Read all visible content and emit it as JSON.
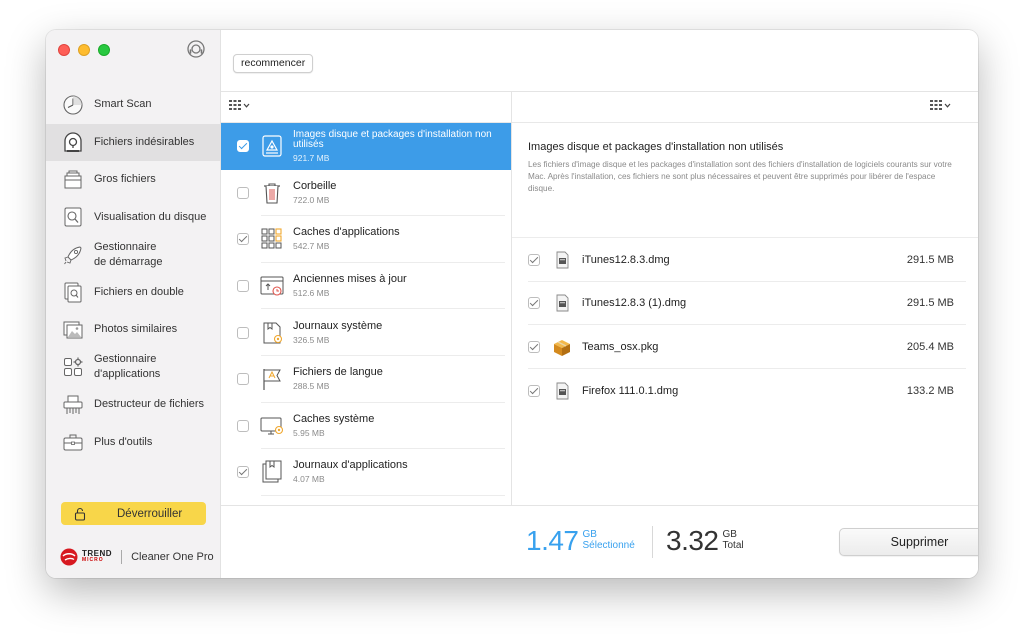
{
  "colors": {
    "accent": "#3d9ce8",
    "selected_stat": "#38a1ee",
    "unlock": "#f8d649"
  },
  "sidebar": {
    "items": [
      {
        "label": "Smart Scan",
        "icon": "smart-scan-icon"
      },
      {
        "label": "Fichiers indésirables",
        "icon": "junk-files-icon",
        "active": true
      },
      {
        "label": "Gros fichiers",
        "icon": "big-files-icon"
      },
      {
        "label": "Visualisation du disque",
        "icon": "disk-map-icon"
      },
      {
        "label_line1": "Gestionnaire",
        "label_line2": "de démarrage",
        "icon": "startup-manager-icon"
      },
      {
        "label": "Fichiers en double",
        "icon": "duplicate-files-icon"
      },
      {
        "label": "Photos similaires",
        "icon": "similar-photos-icon"
      },
      {
        "label_line1": "Gestionnaire",
        "label_line2": "d'applications",
        "icon": "app-manager-icon"
      },
      {
        "label": "Destructeur de fichiers",
        "icon": "file-shredder-icon"
      },
      {
        "label": "Plus d'outils",
        "icon": "more-tools-icon"
      }
    ],
    "unlock_label": "Déverrouiller",
    "brand": {
      "trend": "TREND",
      "micro": "MICRO",
      "product": "Cleaner One Pro"
    }
  },
  "toolbar": {
    "restart_label": "recommencer"
  },
  "categories": [
    {
      "name": "Images disque et packages d'installation non utilisés",
      "size": "921.7 MB",
      "checked": true,
      "selected": true,
      "icon": "installer-package-icon"
    },
    {
      "name": "Corbeille",
      "size": "722.0 MB",
      "checked": false,
      "icon": "trash-icon"
    },
    {
      "name": "Caches d'applications",
      "size": "542.7 MB",
      "checked": true,
      "icon": "app-cache-icon"
    },
    {
      "name": "Anciennes mises à jour",
      "size": "512.6 MB",
      "checked": false,
      "icon": "old-updates-icon"
    },
    {
      "name": "Journaux système",
      "size": "326.5 MB",
      "checked": false,
      "icon": "system-logs-icon"
    },
    {
      "name": "Fichiers de langue",
      "size": "288.5 MB",
      "checked": false,
      "icon": "language-files-icon"
    },
    {
      "name": "Caches système",
      "size": "5.95 MB",
      "checked": false,
      "icon": "system-cache-icon"
    },
    {
      "name": "Journaux d'applications",
      "size": "4.07 MB",
      "checked": true,
      "icon": "app-logs-icon"
    }
  ],
  "detail": {
    "title": "Images disque et packages d'installation non utilisés",
    "description": "Les fichiers d'image disque et les packages d'installation sont des fichiers d'installation de logiciels courants sur votre Mac. Après l'installation, ces fichiers ne sont plus nécessaires et peuvent être supprimés pour libérer de l'espace disque.",
    "files": [
      {
        "name": "iTunes12.8.3.dmg",
        "size": "291.5 MB",
        "icon": "dmg-file-icon",
        "checked": true
      },
      {
        "name": "iTunes12.8.3 (1).dmg",
        "size": "291.5 MB",
        "icon": "dmg-file-icon",
        "checked": true
      },
      {
        "name": "Teams_osx.pkg",
        "size": "205.4 MB",
        "icon": "pkg-file-icon",
        "checked": true
      },
      {
        "name": "Firefox 111.0.1.dmg",
        "size": "133.2 MB",
        "icon": "dmg-file-icon",
        "checked": true
      }
    ]
  },
  "footer": {
    "selected_value": "1.47",
    "selected_unit": "GB",
    "selected_label": "Sélectionné",
    "total_value": "3.32",
    "total_unit": "GB",
    "total_label": "Total",
    "delete_label": "Supprimer"
  }
}
